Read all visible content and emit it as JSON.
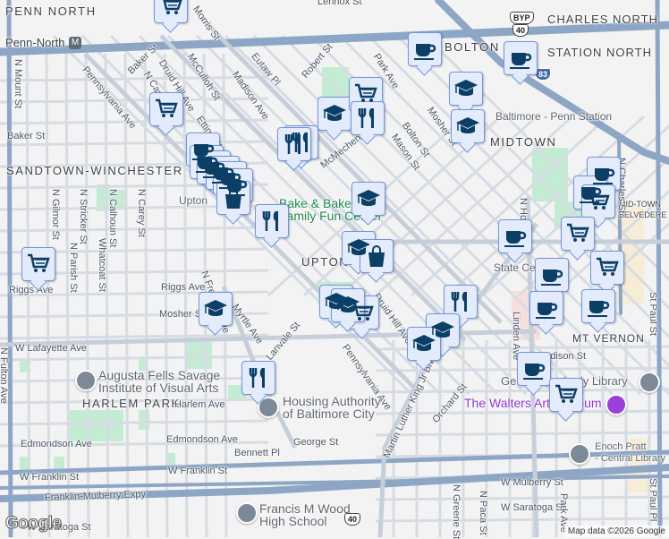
{
  "neighborhoods": [
    "PENN NORTH",
    "SANDTOWN-WINCHESTER",
    "UPTON",
    "MIDTOWN",
    "CHARLES NORTH",
    "STATION NORTH",
    "MT VERNON",
    "HARLEM PARK",
    "MID-TOWN BELVEDERE",
    "BOLTON HILL"
  ],
  "streets": [
    "N Mount St",
    "N Carey St",
    "Pennsylvania Ave",
    "Baker St",
    "Druid Hill Ave",
    "McCulloh St",
    "Eutaw Pl",
    "Madison Ave",
    "Robert St",
    "Park Ave",
    "Bolton St",
    "Mason St",
    "McMechen St",
    "Etting St",
    "Baker St",
    "N Gilmor St",
    "N Stricker St",
    "N Calhoun St",
    "Whatcoat St",
    "N Carey St",
    "Riggs Ave",
    "N Parish St",
    "Riggs Ave",
    "Mosher St",
    "Myrtle Ave",
    "N Fremont Ave",
    "W Lafayette Ave",
    "Lanvale St",
    "N Fulton Ave",
    "Harlem Ave",
    "Edmondson Ave",
    "Edmondson Ave",
    "George St",
    "Bennett Pl",
    "W Franklin St",
    "W Franklin St",
    "Franklin-Mulberry Expy",
    "W Mulberry St",
    "Martin Luther King Jr Blvd",
    "Orchard St",
    "Druid Hill Ave",
    "Pennsylvania Ave",
    "N Howard St",
    "Linden Ave",
    "N Charles St",
    "St Paul St",
    "W Saratoga St",
    "N Greene St",
    "N Paca St",
    "Park Ave",
    "Madison St",
    "Mosher St",
    "Lennox St",
    "Morris St",
    "W Saratoga St",
    "St Paul Pl"
  ],
  "pois": {
    "penn_north": "Penn-North",
    "penn_station": "Baltimore - Penn Station",
    "state_center": "State Center",
    "upton_station": "Upton",
    "augusta": "Augusta Fells Savage\nInstitute of Visual Arts",
    "housing": "Housing Authority\nof Baltimore City",
    "wood": "Francis M Wood\nHigh School",
    "walters": "The Walters Art Museum",
    "library": "George Peabody Library",
    "pratt": "Enoch Pratt\n- Central Library",
    "bake": "Bake & Bake\nFamily Fun Center"
  },
  "route_shields": {
    "byp": "BYP",
    "us40": "40",
    "i83": "83"
  },
  "markers": [
    "grocery",
    "grocery",
    "grocery",
    "cafe",
    "cafe",
    "cafe",
    "cafe",
    "cafe",
    "cafe",
    "shopping",
    "restaurant",
    "restaurant",
    "restaurant",
    "school",
    "grocery",
    "restaurant",
    "school",
    "cafe",
    "school",
    "school",
    "cafe",
    "cafe",
    "cafe",
    "grocery",
    "cafe",
    "grocery",
    "grocery",
    "cafe",
    "cafe",
    "cafe",
    "school",
    "school",
    "grocery",
    "restaurant",
    "school",
    "school",
    "cafe",
    "grocery",
    "school",
    "restaurant",
    "school",
    "shopping"
  ],
  "branding": {
    "logo": "Google",
    "attribution": "Map data ©2026 Google"
  },
  "colors": {
    "marker_bg": "#e4ecfb",
    "marker_border": "#7096dc",
    "icon": "#0b3f66",
    "highway": "#8da4c4",
    "street": "#d3dae2",
    "park": "#c4ecd3"
  }
}
